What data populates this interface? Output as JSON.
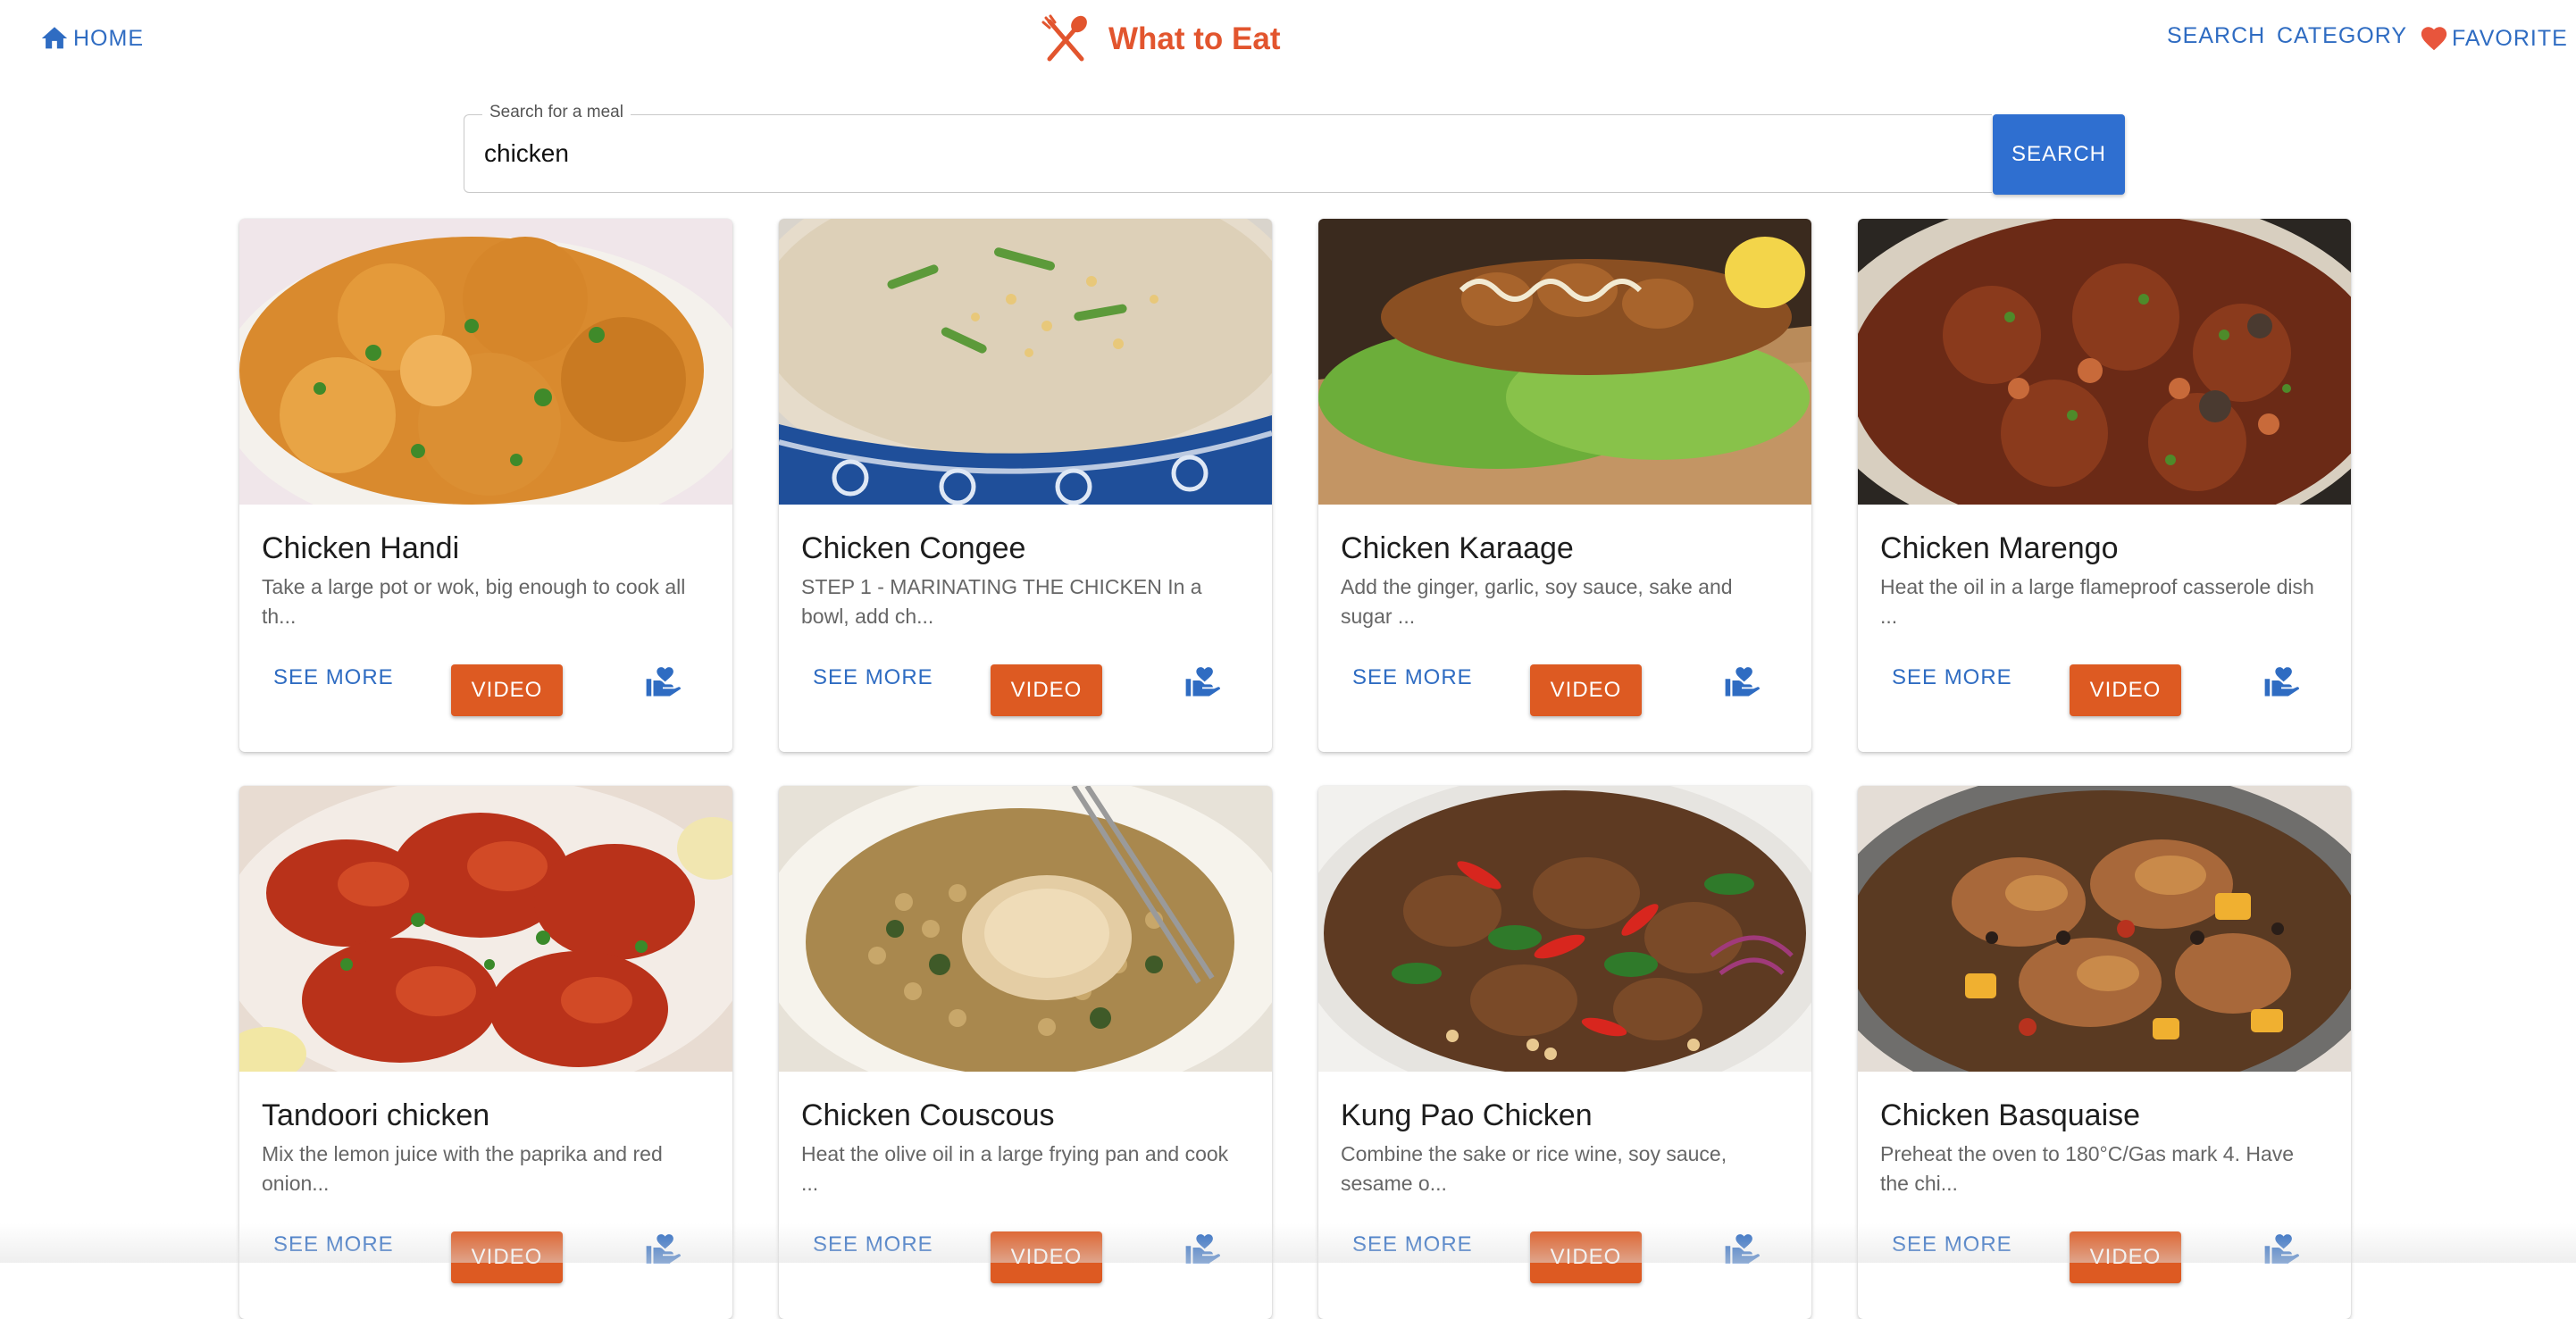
{
  "nav": {
    "home_label": "HOME",
    "brand_title": "What to Eat",
    "search_label": "SEARCH",
    "category_label": "CATEGORY",
    "favorite_label": "FAVORITE",
    "home_icon": "home-icon",
    "brand_icon": "fork-spoon-icon",
    "favorite_icon": "heart-icon"
  },
  "search": {
    "legend": "Search for a meal",
    "value": "chicken",
    "button_label": "SEARCH"
  },
  "colors": {
    "accent_blue": "#2f6cc2",
    "search_button": "#2f6fd0",
    "brand_orange": "#e2552e",
    "video_button": "#dd5a22",
    "favorite_heart": "#e8553c"
  },
  "meals": [
    {
      "title": "Chicken Handi",
      "description": "Take a large pot or wok, big enough to cook all th...",
      "see_more": "SEE MORE",
      "video": "VIDEO"
    },
    {
      "title": "Chicken Congee",
      "description": "STEP 1 - MARINATING THE CHICKEN In a bowl, add ch...",
      "see_more": "SEE MORE",
      "video": "VIDEO"
    },
    {
      "title": "Chicken Karaage",
      "description": "Add the ginger, garlic, soy sauce, sake and sugar ...",
      "see_more": "SEE MORE",
      "video": "VIDEO"
    },
    {
      "title": "Chicken Marengo",
      "description": "Heat the oil in a large flameproof casserole dish ...",
      "see_more": "SEE MORE",
      "video": "VIDEO"
    },
    {
      "title": "Tandoori chicken",
      "description": "Mix the lemon juice with the paprika and red onion...",
      "see_more": "SEE MORE",
      "video": "VIDEO"
    },
    {
      "title": "Chicken Couscous",
      "description": "Heat the olive oil in a large frying pan and cook ...",
      "see_more": "SEE MORE",
      "video": "VIDEO"
    },
    {
      "title": "Kung Pao Chicken",
      "description": "Combine the sake or rice wine, soy sauce, sesame o...",
      "see_more": "SEE MORE",
      "video": "VIDEO"
    },
    {
      "title": "Chicken Basquaise",
      "description": "Preheat the oven to 180°C/Gas mark 4. Have the chi...",
      "see_more": "SEE MORE",
      "video": "VIDEO"
    }
  ]
}
